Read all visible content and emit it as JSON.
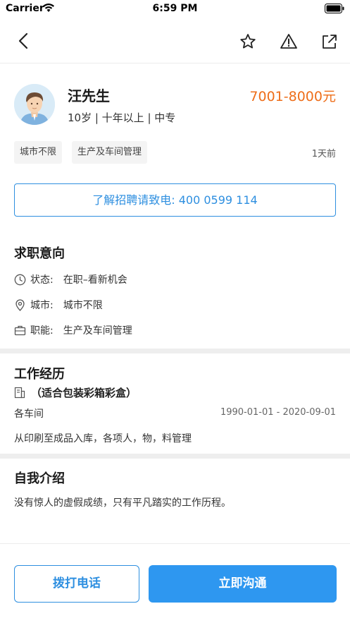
{
  "status_bar": {
    "carrier": "Carrier",
    "time": "6:59 PM"
  },
  "nav": {
    "icons": [
      "back-arrow-icon",
      "star-icon",
      "warning-icon",
      "share-icon"
    ]
  },
  "candidate": {
    "name": "汪先生",
    "salary": "7001-8000元",
    "meta": "10岁 | 十年以上 | 中专",
    "tags": [
      "城市不限",
      "生产及车间管理"
    ],
    "posted": "1天前"
  },
  "hotline": "了解招聘请致电: 400 0599 114",
  "intent": {
    "title": "求职意向",
    "rows": [
      {
        "label": "状态:",
        "value": "在职–看新机会",
        "icon": "clock-icon"
      },
      {
        "label": "城市:",
        "value": "城市不限",
        "icon": "location-icon"
      },
      {
        "label": "职能:",
        "value": "生产及车间管理",
        "icon": "briefcase-icon"
      }
    ]
  },
  "work": {
    "title": "工作经历",
    "company": "（适合包装彩箱彩盒）",
    "department": "各车间",
    "period": "1990-01-01 - 2020-09-01",
    "description": "从印刷至成品入库，各项人，物，料管理"
  },
  "intro": {
    "title": "自我介绍",
    "text": "没有惊人的虚假成绩，只有平凡踏实的工作历程。"
  },
  "actions": {
    "call": "拨打电话",
    "chat": "立即沟通"
  },
  "colors": {
    "accent": "#2e8fe0",
    "salary": "#ee6e1a",
    "primary_button": "#2e97f0"
  }
}
